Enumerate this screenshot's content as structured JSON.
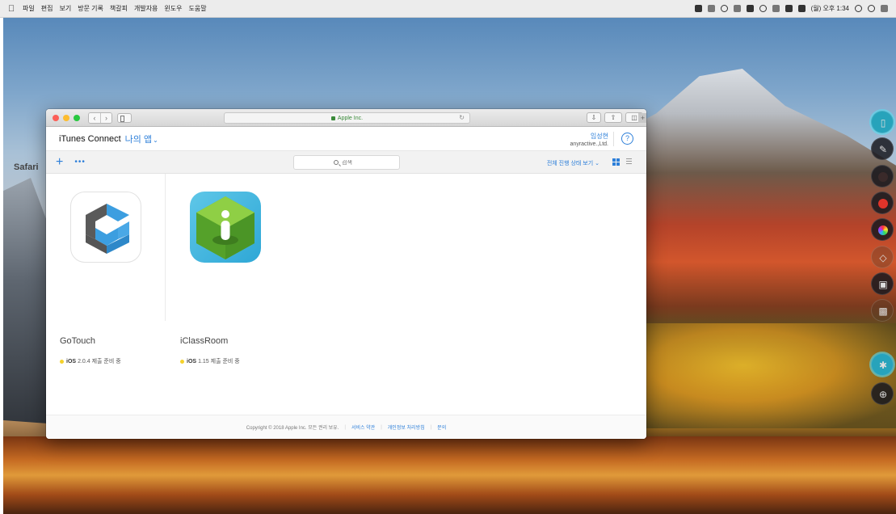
{
  "menubar": {
    "app_name": "Safari",
    "items": [
      "파일",
      "편집",
      "보기",
      "방문 기록",
      "책갈피",
      "개발자용",
      "윈도우",
      "도움말"
    ],
    "clock": "(월) 오후 1:34"
  },
  "browser": {
    "address": "Apple Inc."
  },
  "itc": {
    "title": "iTunes Connect",
    "my_apps": "나의 앱",
    "user_name": "임성현",
    "user_org": "anyractive.,Ltd.",
    "help": "?",
    "add": "+",
    "more": "•••",
    "search_placeholder": "검색",
    "filter_label": "전체 진행 상태 보기"
  },
  "apps": [
    {
      "name": "GoTouch",
      "platform": "iOS",
      "status": "2.0.4 제출 준비 중"
    },
    {
      "name": "iClassRoom",
      "platform": "iOS",
      "status": "1.15 제출 준비 중"
    }
  ],
  "footer": {
    "copyright": "Copyright © 2018 Apple Inc. 모든 권리 보유.",
    "links": [
      "서비스 약관",
      "개인정보 처리방침",
      "문의"
    ]
  },
  "colors": {
    "link_blue": "#2d7fd9",
    "status_yellow": "#f5d22b",
    "palette_active": "#27a3bb"
  },
  "palette": {
    "tools": [
      "mouse-icon",
      "pen-icon",
      "black-color",
      "red-color",
      "rainbow-color",
      "eraser-icon",
      "camera-icon",
      "lock-icon",
      "bluetooth-icon",
      "crosshair-icon"
    ]
  }
}
